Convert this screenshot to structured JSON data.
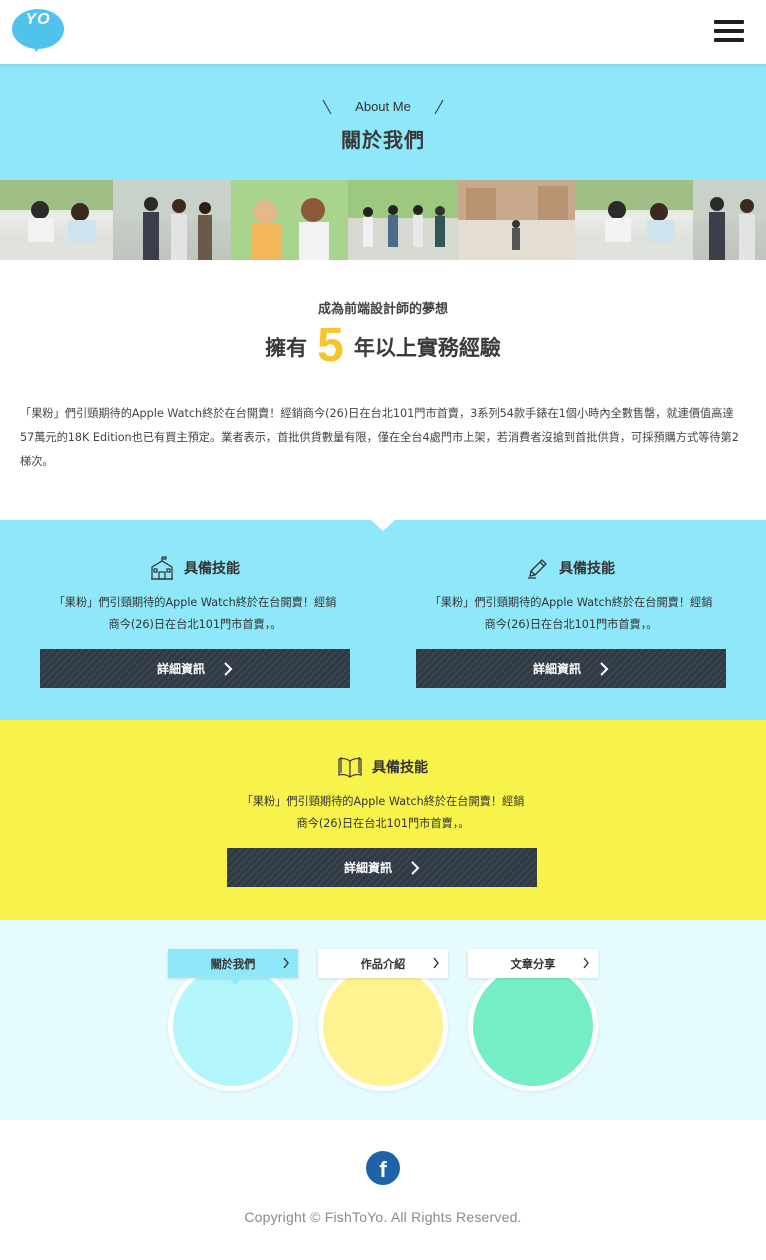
{
  "header": {
    "logo_text": "YO",
    "menu_icon": "hamburger-menu-icon"
  },
  "banner": {
    "subtitle": "About Me",
    "title": "關於我們"
  },
  "intro": {
    "kicker": "成為前端設計師的夢想",
    "headline_pre": "擁有",
    "headline_number": "5",
    "headline_post": "年以上實務經驗",
    "body": "「果粉」們引頸期待的Apple Watch終於在台開賣！經銷商今(26)日在台北101門市首賣，3系列54款手錶在1個小時內全數售罄，就連價值高達57萬元的18K Edition也已有買主預定。業者表示，首批供貨數量有限，僅在全台4處門市上架，若消費者沒搶到首批供貨，可採預購方式等待第2梯次。"
  },
  "skills": [
    {
      "icon": "school-building-icon",
      "title": "具備技能",
      "desc_line1": "「果粉」們引頸期待的Apple Watch終於在台開賣！經銷",
      "desc_line2": "商今(26)日在台北101門市首賣，。",
      "button": "詳細資訊"
    },
    {
      "icon": "pencil-icon",
      "title": "具備技能",
      "desc_line1": "「果粉」們引頸期待的Apple Watch終於在台開賣！經銷",
      "desc_line2": "商今(26)日在台北101門市首賣，。",
      "button": "詳細資訊"
    },
    {
      "icon": "open-book-icon",
      "title": "具備技能",
      "desc_line1": "「果粉」們引頸期待的Apple Watch終於在台開賣！經銷",
      "desc_line2": "商今(26)日在台北101門市首賣，。",
      "button": "詳細資訊"
    }
  ],
  "nav_cards": [
    {
      "label": "關於我們",
      "color": "#b2f5fb",
      "active": true
    },
    {
      "label": "作品介紹",
      "color": "#fff291"
    },
    {
      "label": "文章分享",
      "color": "#75edc7"
    }
  ],
  "footer": {
    "facebook_icon": "facebook-icon",
    "copyright": "Copyright © FishToYo. All Rights Reserved."
  },
  "colors": {
    "accent_blue": "#8ee8f9",
    "accent_yellow": "#f8f34a",
    "number_gold": "#f7c42b",
    "button_dark": "#2f3a44"
  }
}
